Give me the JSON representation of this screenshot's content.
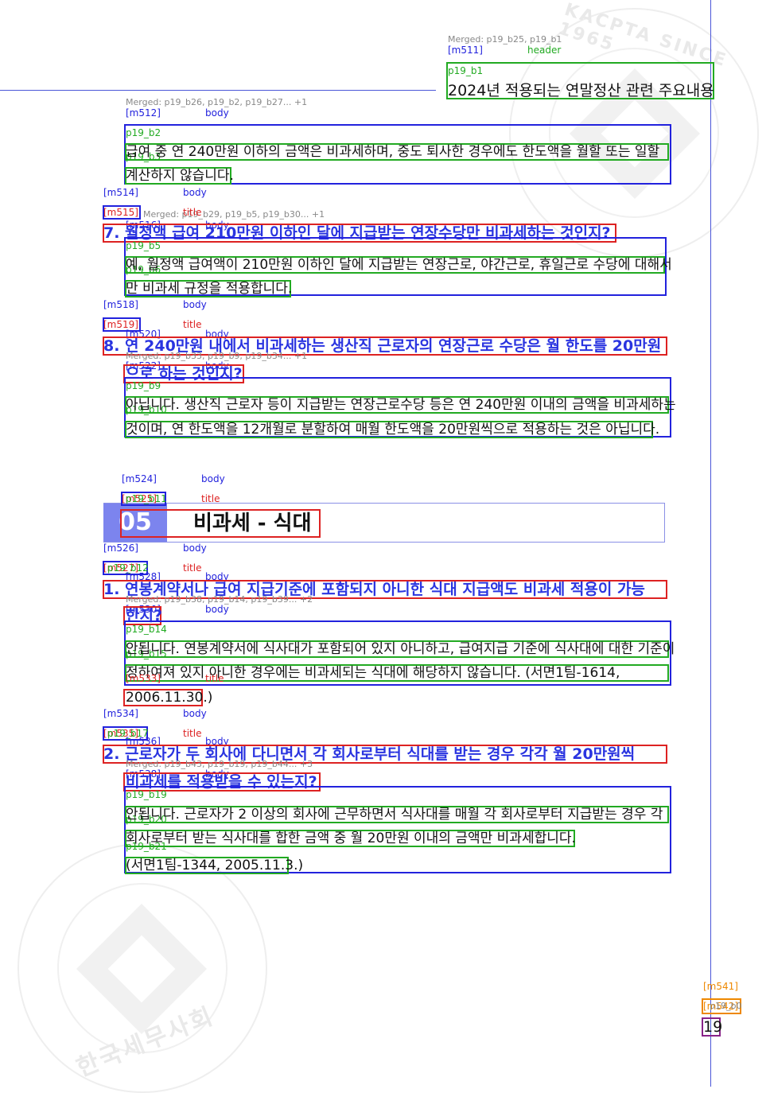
{
  "watermark": {
    "top_text": "KACPTA SINCE 1965",
    "bottom_text": "한국세무사회"
  },
  "header": {
    "merged_note": "Merged: p19_b25, p19_b1",
    "id": "[m511]",
    "kind": "header",
    "block": "p19_b1",
    "title": "2024년 적용되는 연말정산 관련 주요내용"
  },
  "blocks": {
    "m512": {
      "merged": "Merged: p19_b26, p19_b2, p19_b27... +1",
      "id": "[m512]",
      "kind": "body",
      "b_id": "p19_b2",
      "b_id2": "p19_b3",
      "line1": "급여 중 연 240만원 이하의 금액은 비과세하며, 중도 퇴사한 경우에도 한도액을 월할 또는 일할",
      "line2": "계산하지 않습니다."
    },
    "m514": {
      "id": "[m514]",
      "kind": "body"
    },
    "m515": {
      "id": "[m515]",
      "b_id": "p19_b4",
      "kind": "title",
      "merged": "Merged: p19_b29, p19_b5, p19_b30... +1",
      "sub_id": "[m516]",
      "sub_kind": "body",
      "title": "7. 월정액 급여 210만원 이하인 달에 지급받는 연장수당만 비과세하는 것인지?"
    },
    "m517": {
      "b_id": "p19_b5",
      "b_id2": "p19_b6",
      "line1": "예, 월정액 급여액이 210만원 이하인 달에 지급받는 연장근로, 야간근로, 휴일근로 수당에 대해서",
      "line2": "만 비과세 규정을 적용합니다."
    },
    "m518": {
      "id": "[m518]",
      "kind": "body"
    },
    "m519": {
      "id": "[m519]",
      "b_id": "p19_b7",
      "kind": "title",
      "sub_id": "[m520]",
      "sub_kind": "body",
      "b_id2": "p19_b8",
      "merged": "Merged: p19_b33, p19_b9, p19_b34... +1",
      "sub2_id": "[m522]",
      "sub2_kind": "body",
      "title1": "8. 연 240만원 내에서 비과세하는 생산직 근로자의 연장근로 수당은 월 한도를 20만원",
      "title2": "으로 하는 것인지?"
    },
    "m523": {
      "b_id": "p19_b9",
      "b_id2": "p19_b10",
      "line1": "아닙니다. 생산직 근로자 등이 지급받는 연장근로수당 등은 연 240만원 이내의 금액을 비과세하는",
      "line2": "것이며, 연 한도액을 12개월로 분할하여 매월 한도액을 20만원씩으로 적용하는 것은 아닙니다."
    },
    "m524": {
      "id": "[m524]",
      "kind": "body",
      "sub_id": "[m525]",
      "b_id": "p19_b11",
      "sub_kind": "title",
      "sec_num": "05",
      "sec_title": "비과세 - 식대"
    },
    "m526": {
      "id": "[m526]",
      "kind": "body"
    },
    "m527": {
      "id": "[m527]",
      "b_id": "p19_b12",
      "kind": "title",
      "sub_id": "[m528]",
      "sub_kind": "body",
      "merged": "Merged: p19_b38, p19_b14, p19_b39... +2",
      "sub2_id": "[m530]",
      "sub2_kind": "body",
      "title1": "1. 연봉계약서나 급여 지급기준에 포함되지 아니한 식대 지급액도 비과세 적용이 가능",
      "title2": "한지?"
    },
    "m531": {
      "b_id": "p19_b14",
      "b_id2": "p19_b15",
      "tag_id": "[m533]",
      "tag_kind": "title",
      "line1": "안됩니다. 연봉계약서에 식사대가 포함되어 있지 아니하고, 급여지급 기준에 식사대에 대한 기준이",
      "line2": "정하여져 있지 아니한 경우에는 비과세되는 식대에 해당하지 않습니다. (서면1팀-1614,",
      "line3": "2006.11.30.)"
    },
    "m534": {
      "id": "[m534]",
      "kind": "body"
    },
    "m535": {
      "id": "[m535]",
      "b_id": "p19_b17",
      "kind": "title",
      "sub_id": "[m536]",
      "sub_kind": "body",
      "merged": "Merged: p19_b43, p19_b19, p19_b44... +3",
      "sub2_id": "[m538]",
      "sub2_kind": "body",
      "title1": "2. 근로자가 두 회사에 다니면서 각 회사로부터 식대를 받는 경우 각각 월 20만원씩",
      "title2": "비과세를 적용받을 수 있는지?"
    },
    "m539": {
      "b_id": "p19_b19",
      "b_id2": "p19_b20",
      "b_id3": "p19_b21",
      "line1": "안됩니다. 근로자가 2 이상의 회사에 근무하면서 식사대를 매월 각 회사로부터 지급받는 경우 각",
      "line2": "회사로부터 받는 식사대를 합한 금액 중 월 20만원 이내의 금액만 비과세합니다.",
      "line3": "(서면1팀-1344, 2005.11.3.)"
    }
  },
  "footer": {
    "id": "[m541]",
    "sub_id": "[m542]",
    "b_id": "p19_b0",
    "page": "19"
  },
  "colors": {
    "accent": "#7c84ee",
    "annotation_blue": "#2222dd",
    "annotation_green": "#22aa22",
    "annotation_red": "#dd2222",
    "annotation_orange": "#ee8800"
  }
}
